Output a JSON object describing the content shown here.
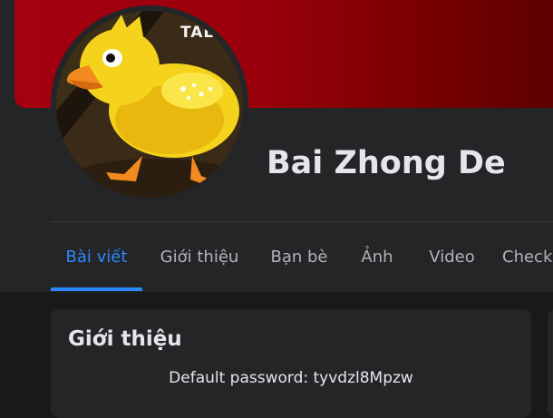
{
  "profile": {
    "name": "Bai Zhong De",
    "avatar_text": "TALO",
    "cover_color": "#9a000c"
  },
  "tabs": [
    {
      "label": "Bài viết",
      "active": true
    },
    {
      "label": "Giới thiệu",
      "active": false
    },
    {
      "label": "Bạn bè",
      "active": false
    },
    {
      "label": "Ảnh",
      "active": false
    },
    {
      "label": "Video",
      "active": false
    },
    {
      "label": "Check",
      "active": false
    }
  ],
  "intro": {
    "title": "Giới thiệu",
    "bio": "Default password: tyvdzl8Mpzw"
  },
  "colors": {
    "accent": "#2d88ff",
    "background": "#18191a",
    "surface": "#242526"
  }
}
